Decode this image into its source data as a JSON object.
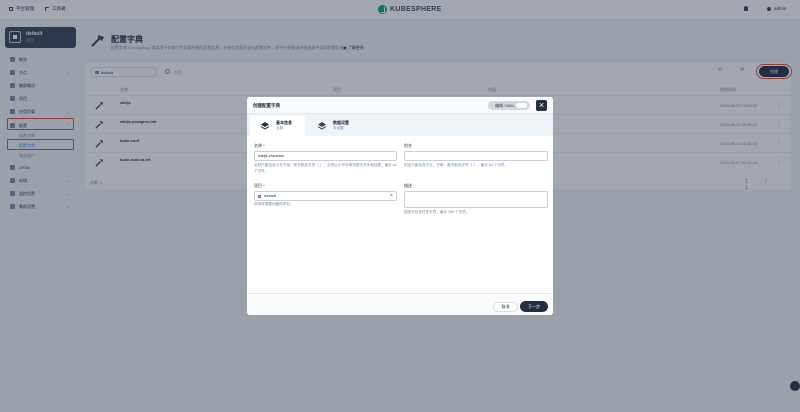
{
  "topbar": {
    "platform": "平台管理",
    "toolbox": "工具箱",
    "logo": "KUBESPHERE",
    "user": "admin"
  },
  "workspace": {
    "name": "default",
    "type": "项目"
  },
  "sidebar": {
    "items": [
      {
        "label": "概览"
      },
      {
        "label": "节点"
      },
      {
        "label": "集群概况"
      },
      {
        "label": "项目"
      },
      {
        "label": "应用负载"
      },
      {
        "label": "配置"
      },
      {
        "label": "CRDs"
      },
      {
        "label": "存储"
      },
      {
        "label": "监控告警"
      },
      {
        "label": "集群设置"
      }
    ],
    "config_sub": [
      "保密字典",
      "配置字典",
      "服务帐户"
    ]
  },
  "page": {
    "title": "配置字典",
    "description": "配置字典 (ConfigMap) 通常用于存储工作负载所需的配置信息，许多应用程序会从配置文件、命令行参数或环境变量中读取配置信息。",
    "learn_more": "了解更多"
  },
  "toolbar": {
    "namespace": "default",
    "search_placeholder": "搜索",
    "create": "创建"
  },
  "table": {
    "columns": [
      "名称",
      "项目",
      "字段",
      "创建时间"
    ],
    "rows": [
      {
        "name": "wikijs",
        "time": "2024-06-20 10:03:34"
      },
      {
        "name": "wikijs-postgres-init",
        "time": "2024-06-20 09:58:29"
      },
      {
        "name": "kube-conf",
        "time": "2024-06-13 11:53:44"
      },
      {
        "name": "kube-root-ca.crt",
        "time": "2024-06-07 03:12:14"
      }
    ],
    "footer": "总数: 4",
    "pager": "1 / 1"
  },
  "modal": {
    "title": "创建配置字典",
    "yaml_label": "编辑 YAML",
    "tabs": [
      {
        "label": "基本信息",
        "status": "当前"
      },
      {
        "label": "数据设置",
        "status": "未设置"
      }
    ],
    "name_label": "名称 *",
    "name_value": "wikijs-zhparser",
    "name_help": "名称只能包含小写字母、数字和连字符（-），必须以小写字母或数字开头和结尾，最长 63 个字符。",
    "alias_label": "别名",
    "alias_help": "别名只能包含中文、字母、数字和连字符（-），最长 63 个字符。",
    "project_label": "项目 *",
    "project_value": "default",
    "project_help": "选择资源要创建的项目。",
    "desc_label": "描述",
    "desc_help": "描述可包含任意字符，最长 256 个字符。",
    "cancel": "取消",
    "next": "下一步"
  }
}
